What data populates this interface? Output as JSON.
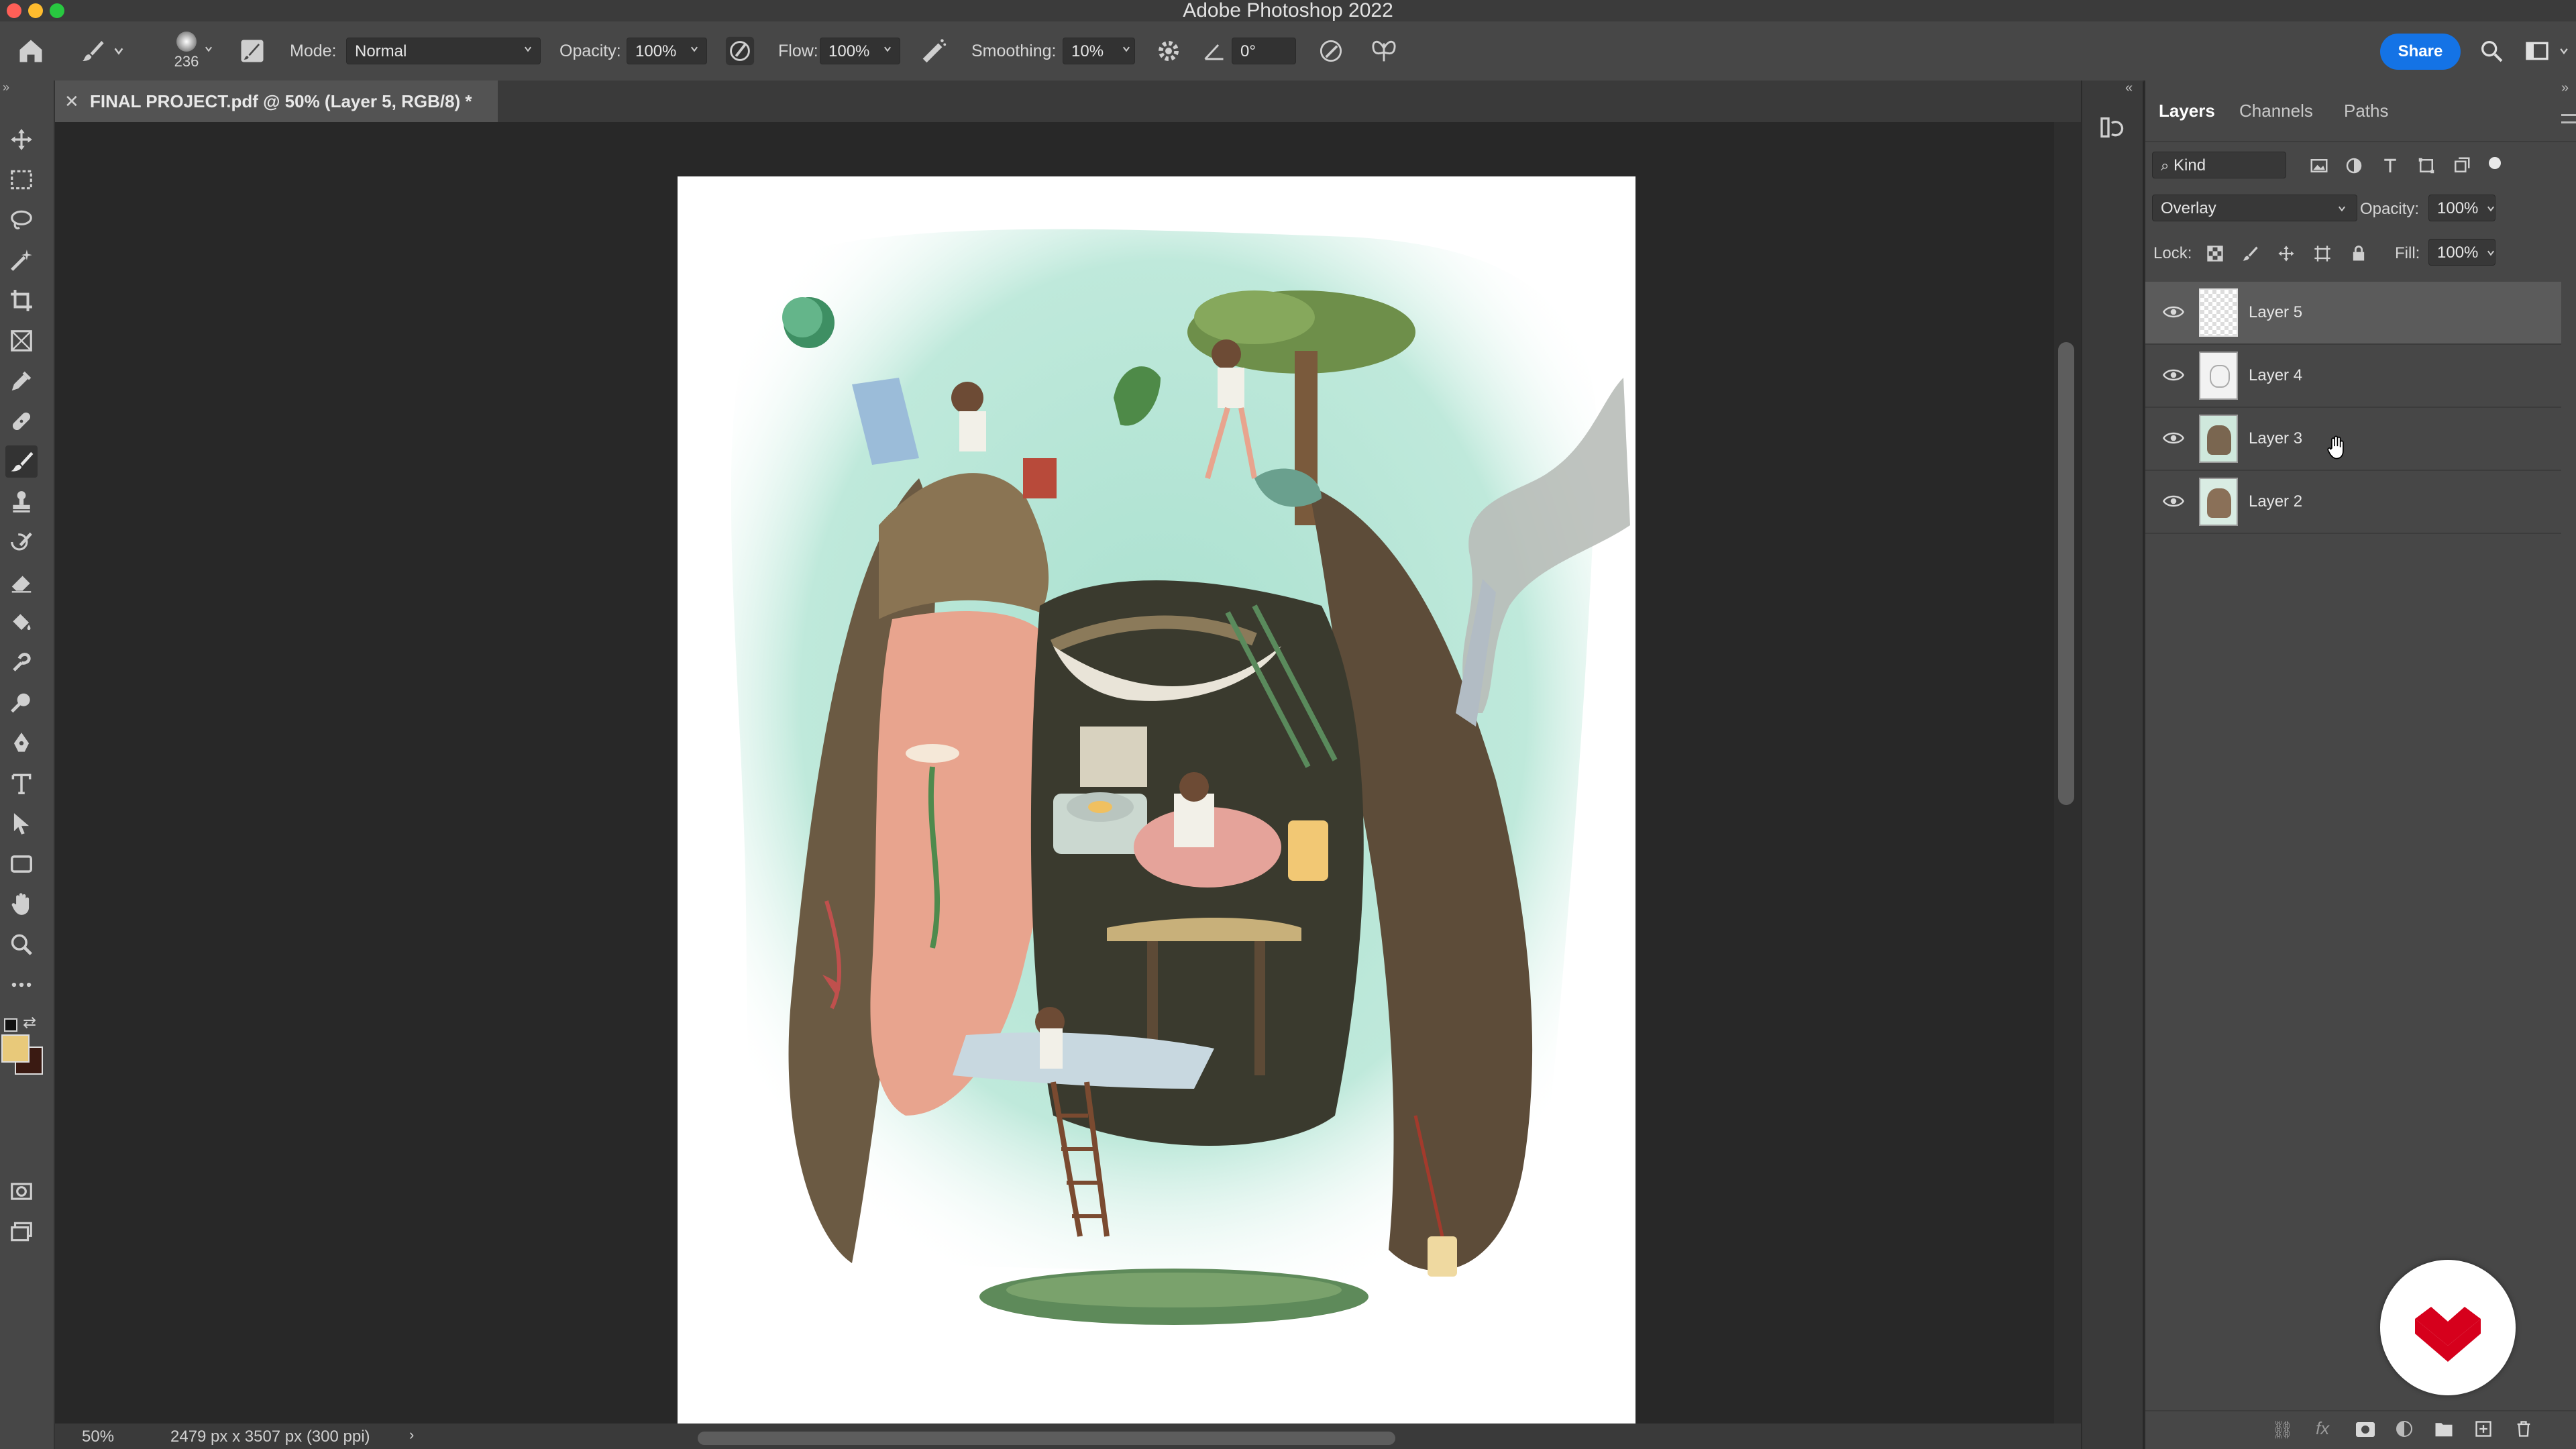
{
  "app": {
    "title": "Adobe Photoshop 2022"
  },
  "options_bar": {
    "brush_size": "236",
    "mode_label": "Mode:",
    "mode_value": "Normal",
    "opacity_label": "Opacity:",
    "opacity_value": "100%",
    "flow_label": "Flow:",
    "flow_value": "100%",
    "smoothing_label": "Smoothing:",
    "smoothing_value": "10%",
    "angle_value": "0°",
    "share_label": "Share"
  },
  "document": {
    "tab_title": "FINAL PROJECT.pdf @ 50% (Layer 5, RGB/8) *",
    "zoom": "50%",
    "doc_info": "2479 px x 3507 px (300 ppi)"
  },
  "layers_panel": {
    "tabs": [
      "Layers",
      "Channels",
      "Paths"
    ],
    "active_tab": "Layers",
    "filter_label": "Kind",
    "blend_mode": "Overlay",
    "opacity_label": "Opacity:",
    "opacity_value": "100%",
    "lock_label": "Lock:",
    "fill_label": "Fill:",
    "fill_value": "100%",
    "layers": [
      {
        "name": "Layer 5",
        "selected": true
      },
      {
        "name": "Layer 4",
        "selected": false
      },
      {
        "name": "Layer 3",
        "selected": false
      },
      {
        "name": "Layer 2",
        "selected": false
      }
    ]
  },
  "colors": {
    "foreground": "#e8c97a",
    "background": "#3a1a12",
    "accent": "#1473e6",
    "logo_red": "#d6001c"
  },
  "icons": [
    "home-icon",
    "brush-icon",
    "move-icon",
    "marquee-icon",
    "lasso-icon",
    "magic-wand-icon",
    "crop-icon",
    "frame-icon",
    "eyedropper-icon",
    "healing-icon",
    "brush-tool-icon",
    "stamp-icon",
    "history-brush-icon",
    "eraser-icon",
    "paint-bucket-icon",
    "smudge-icon",
    "dodge-icon",
    "pen-icon",
    "type-icon",
    "path-select-icon",
    "rectangle-icon",
    "hand-icon",
    "zoom-icon",
    "more-icon",
    "eye-icon",
    "search-icon",
    "workspace-icon"
  ]
}
